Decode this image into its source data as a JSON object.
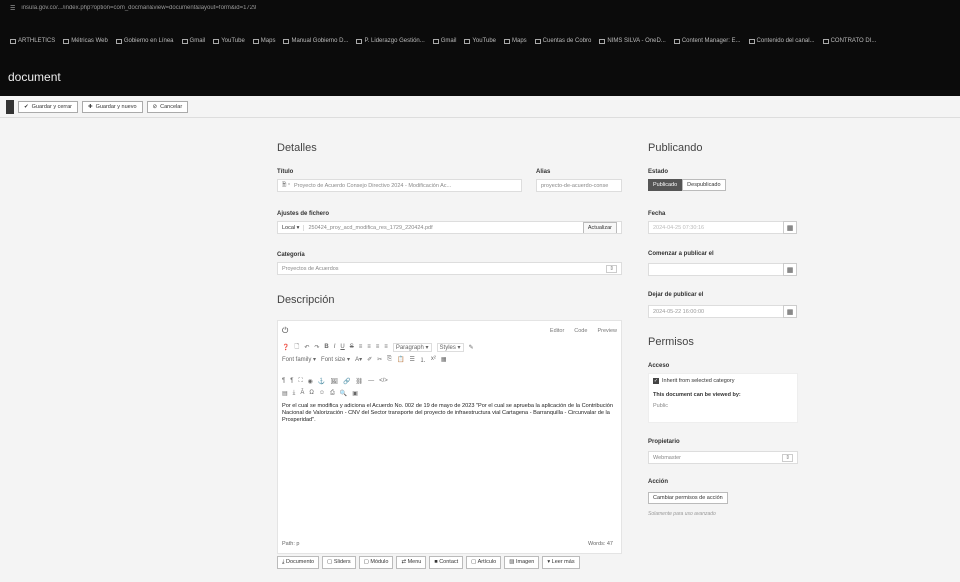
{
  "browser": {
    "url": "insula.gov.co/.../index.php?option=com_docman&view=document&layout=form&id=1729",
    "bookmarks": [
      "ARTHLETICS",
      "Métricas Web",
      "Gobierno en Línea",
      "Gmail",
      "YouTube",
      "Maps",
      "Manual Gobierno D...",
      "P. Liderazgo Gestión...",
      "Gmail",
      "YouTube",
      "Maps",
      "Cuentas de Cobro",
      "NIMS SILVA - OneD...",
      "Content Manager: E...",
      "Contenido del canal...",
      "CONTRATO DI..."
    ]
  },
  "app": {
    "title": "document"
  },
  "toolbar": {
    "save_close": "Guardar y cerrar",
    "save_new": "Guardar y nuevo",
    "cancel": "Cancelar"
  },
  "details": {
    "heading": "Detalles",
    "title_label": "Título",
    "title_value": "Proyecto de Acuerdo Consejo Directivo 2024 - Modificación Ac...",
    "alias_label": "Alias",
    "alias_value": "proyecto-de-acuerdo-conse",
    "file_label": "Ajustes de fichero",
    "file_source": "Local",
    "file_value": "250424_proy_acd_modifica_res_1729_220424.pdf",
    "update_btn": "Actualizar",
    "category_label": "Categoría",
    "category_value": "Proyectos de Acuerdos"
  },
  "description": {
    "heading": "Descripción",
    "editor_tabs": [
      "Editor",
      "Code",
      "Preview"
    ],
    "toolbar_row1": [
      "B",
      "I",
      "U",
      "S",
      "Paragraph",
      "Styles"
    ],
    "toolbar_row2": [
      "Font family",
      "Font size"
    ],
    "content": "Por el cual se modifica y adiciona el Acuerdo No. 002 de 19 de mayo de 2023 \"Por el cual se aprueba la aplicación de la Contribución Nacional de Valorización - CNV del Sector transporte del proyecto de infraestructura vial Cartagena - Barranquilla - Circunvalar de la Prosperidad\".",
    "path_label": "Path: p",
    "words_label": "Words: 47"
  },
  "ext_buttons": [
    "Documento",
    "Sliders",
    "Módulo",
    "Menu",
    "Contact",
    "Artículo",
    "Imagen",
    "Leer más"
  ],
  "publishing": {
    "heading": "Publicando",
    "state_label": "Estado",
    "published": "Publicado",
    "unpublished": "Despublicado",
    "date_label": "Fecha",
    "date_value": "2024-04-25 07:30:16",
    "start_label": "Comenzar a publicar el",
    "end_label": "Dejar de publicar el",
    "end_value": "2024-05-22 16:00:00"
  },
  "permissions": {
    "heading": "Permisos",
    "access_label": "Acceso",
    "inherit_label": "Inherit from selected category",
    "viewed_by_label": "This document can be viewed by:",
    "viewed_by_value": "Public",
    "owner_label": "Propietario",
    "owner_value": "Webmaster",
    "action_label": "Acción",
    "change_btn": "Cambiar permisos de acción",
    "action_note": "Solamente para uso avanzado"
  },
  "colors": {
    "accent": "#555555",
    "topbar": "#0b0b0b"
  }
}
